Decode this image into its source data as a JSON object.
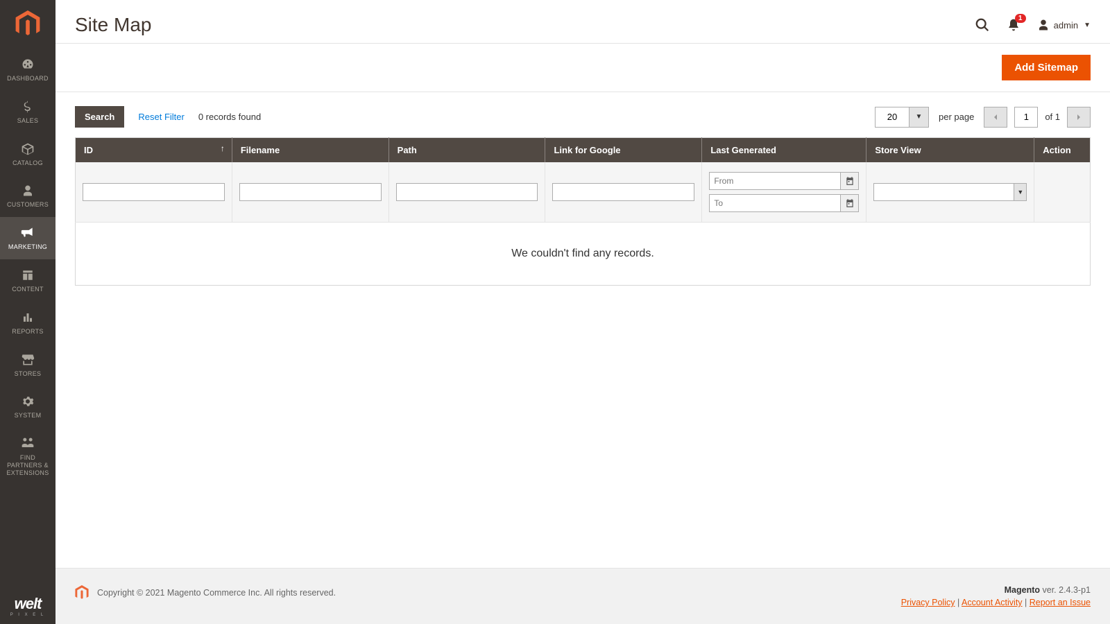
{
  "sidebar": {
    "items": [
      {
        "label": "Dashboard"
      },
      {
        "label": "Sales"
      },
      {
        "label": "Catalog"
      },
      {
        "label": "Customers"
      },
      {
        "label": "Marketing"
      },
      {
        "label": "Content"
      },
      {
        "label": "Reports"
      },
      {
        "label": "Stores"
      },
      {
        "label": "System"
      },
      {
        "label": "Find Partners & Extensions"
      }
    ]
  },
  "header": {
    "title": "Site Map",
    "notification_count": "1",
    "username": "admin"
  },
  "toolbar": {
    "add_button": "Add Sitemap"
  },
  "grid": {
    "search_label": "Search",
    "reset_label": "Reset Filter",
    "records_text": "0 records found",
    "per_page_value": "20",
    "per_page_label": "per page",
    "page_current": "1",
    "page_of": "of 1",
    "columns": {
      "id": "ID",
      "filename": "Filename",
      "path": "Path",
      "link": "Link for Google",
      "last_gen": "Last Generated",
      "store_view": "Store View",
      "action": "Action"
    },
    "filters": {
      "from_placeholder": "From",
      "to_placeholder": "To"
    },
    "empty_text": "We couldn't find any records."
  },
  "footer": {
    "copyright": "Copyright © 2021 Magento Commerce Inc. All rights reserved.",
    "product": "Magento",
    "version": " ver. 2.4.3-p1",
    "links": {
      "privacy": "Privacy Policy",
      "activity": " Account Activity",
      "report": "Report an Issue"
    },
    "sep": " | "
  }
}
